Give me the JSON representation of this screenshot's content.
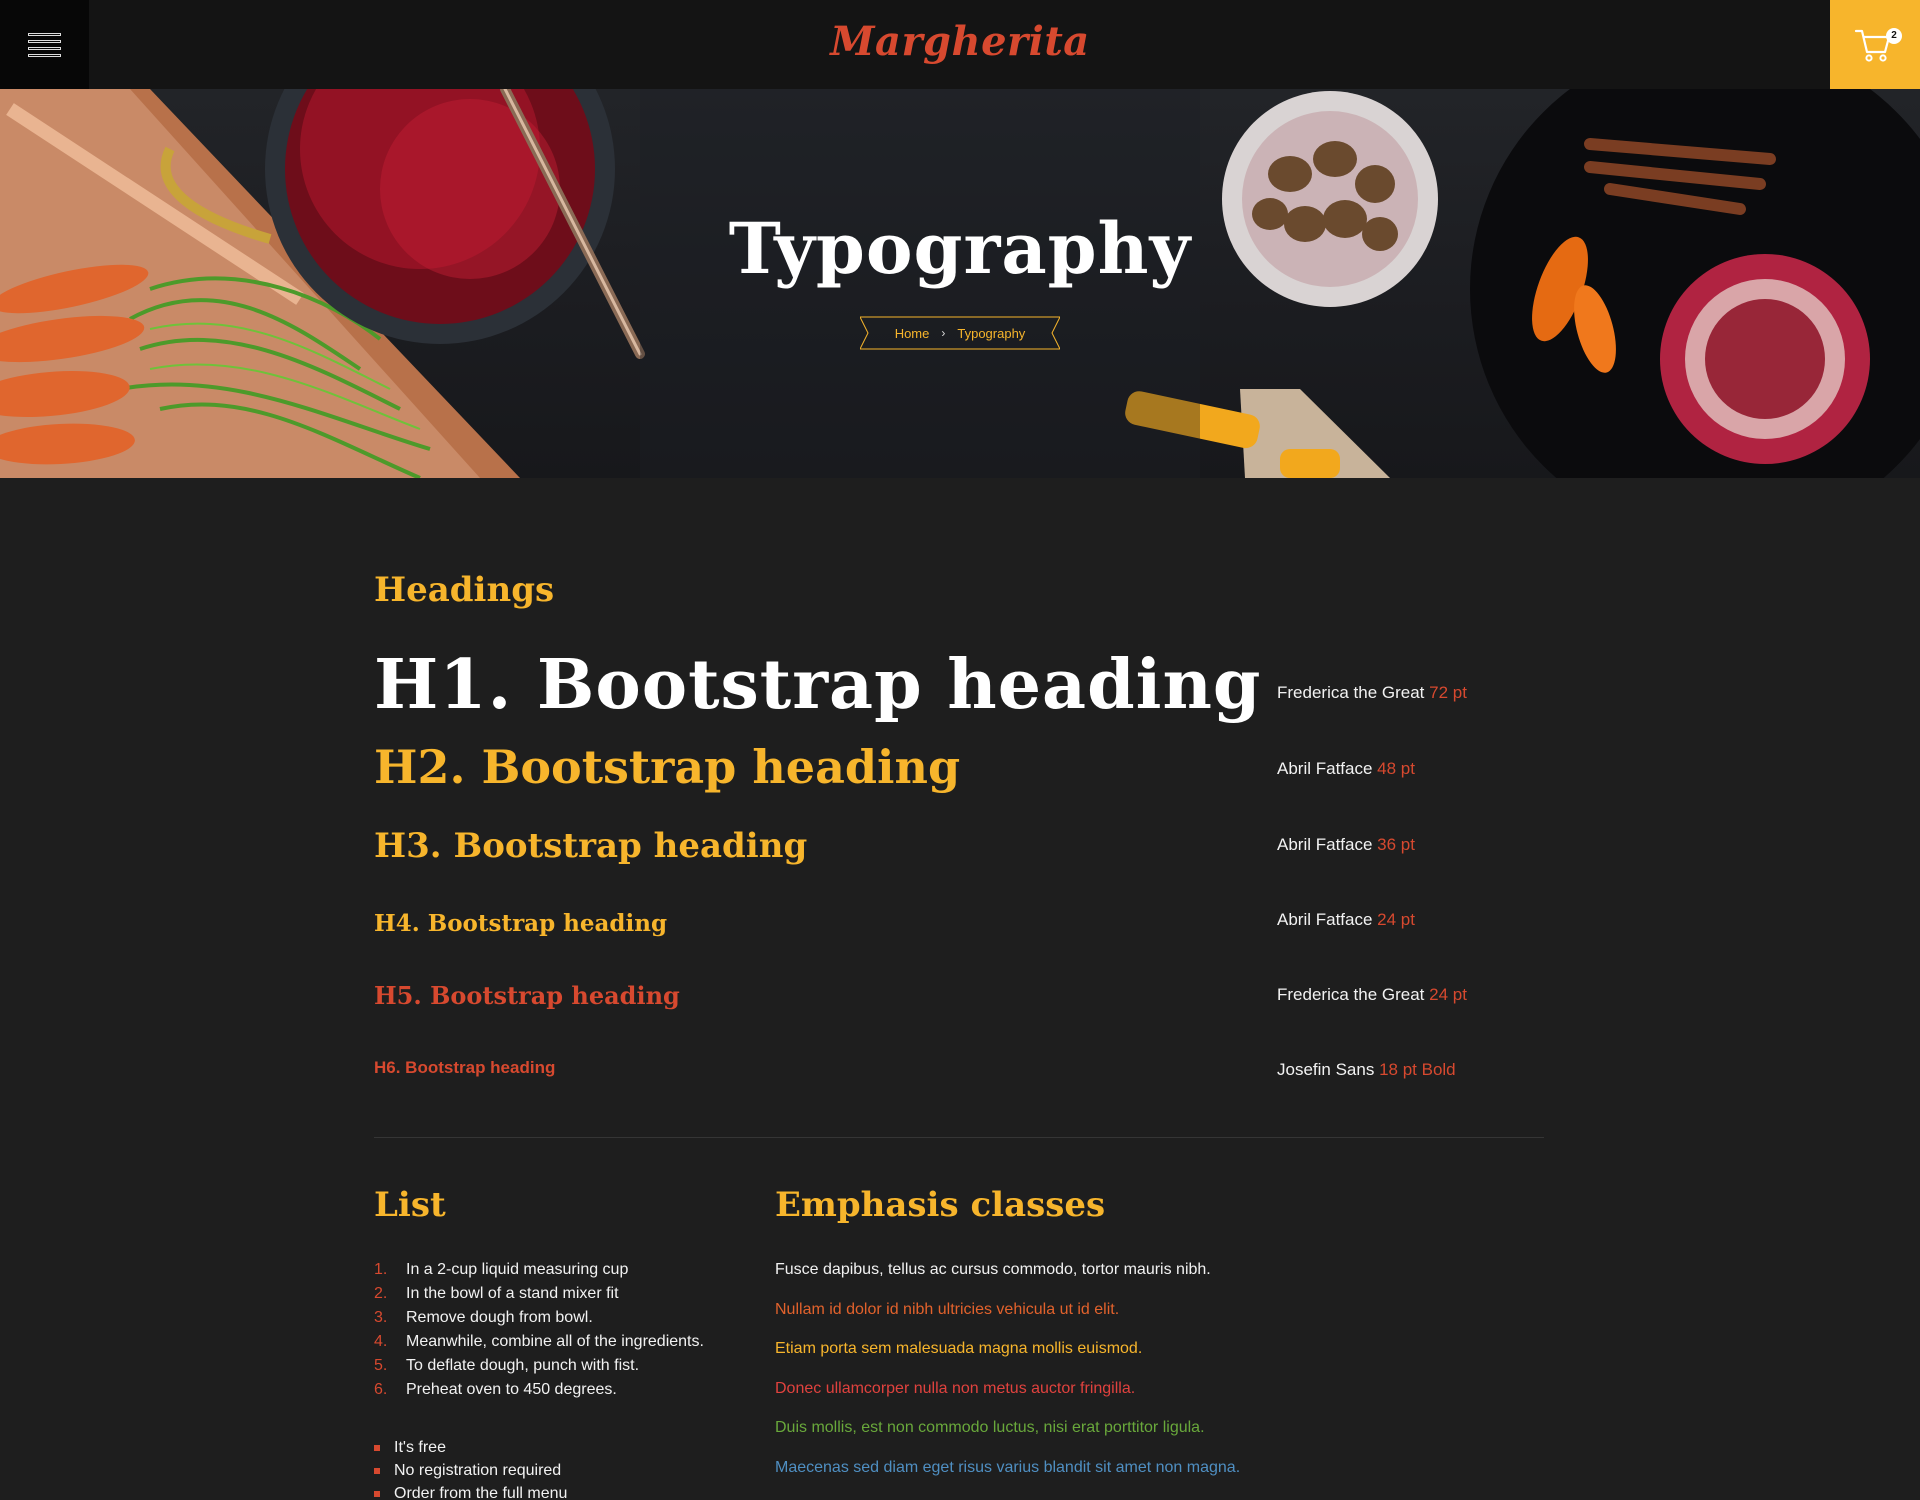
{
  "header": {
    "logo": "Margherita",
    "cart_count": "2",
    "colors": {
      "bar": "#141414",
      "logo": "#d7492f",
      "cart": "#f7b52c"
    }
  },
  "hero": {
    "title": "Typography",
    "breadcrumb": {
      "home": "Home",
      "separator": "›",
      "current": "Typography"
    }
  },
  "headings_section": {
    "title": "Headings",
    "rows": [
      {
        "heading": "H1. Bootstrap heading",
        "font": "Frederica the Great",
        "size": "72 pt"
      },
      {
        "heading": "H2. Bootstrap heading",
        "font": "Abril Fatface",
        "size": "48 pt"
      },
      {
        "heading": "H3. Bootstrap heading",
        "font": "Abril Fatface",
        "size": "36 pt"
      },
      {
        "heading": "H4. Bootstrap heading",
        "font": "Abril Fatface",
        "size": "24 pt"
      },
      {
        "heading": "H5. Bootstrap heading",
        "font": "Frederica the Great",
        "size": "24 pt"
      },
      {
        "heading": "H6. Bootstrap heading",
        "font": "Josefin Sans",
        "size": "18 pt Bold"
      }
    ]
  },
  "list_section": {
    "title": "List",
    "ordered": [
      {
        "num": "1.",
        "text": "In a 2-cup liquid measuring cup"
      },
      {
        "num": "2.",
        "text": "In the bowl of a stand mixer fit"
      },
      {
        "num": "3.",
        "text": "Remove dough from bowl."
      },
      {
        "num": "4.",
        "text": "Meanwhile, combine all of the ingredients."
      },
      {
        "num": "5.",
        "text": "To deflate dough, punch with fist."
      },
      {
        "num": "6.",
        "text": "Preheat oven to 450 degrees."
      }
    ],
    "unordered": [
      "It's free",
      "No registration required",
      "Order from the full menu"
    ]
  },
  "emphasis_section": {
    "title": "Emphasis classes",
    "lines": [
      {
        "text": "Fusce dapibus, tellus ac cursus commodo, tortor mauris nibh.",
        "color": "#f2f2f2"
      },
      {
        "text": "Nullam id dolor id nibh ultricies vehicula ut id elit.",
        "color": "#e2622c"
      },
      {
        "text": "Etiam porta sem malesuada magna mollis euismod.",
        "color": "#f7b52c"
      },
      {
        "text": "Donec ullamcorper nulla non metus auctor fringilla.",
        "color": "#e0423e"
      },
      {
        "text": "Duis mollis, est non commodo luctus, nisi erat porttitor ligula.",
        "color": "#69a83b"
      },
      {
        "text": "Maecenas sed diam eget risus varius blandit sit amet non magna.",
        "color": "#4f8fc2"
      }
    ]
  }
}
